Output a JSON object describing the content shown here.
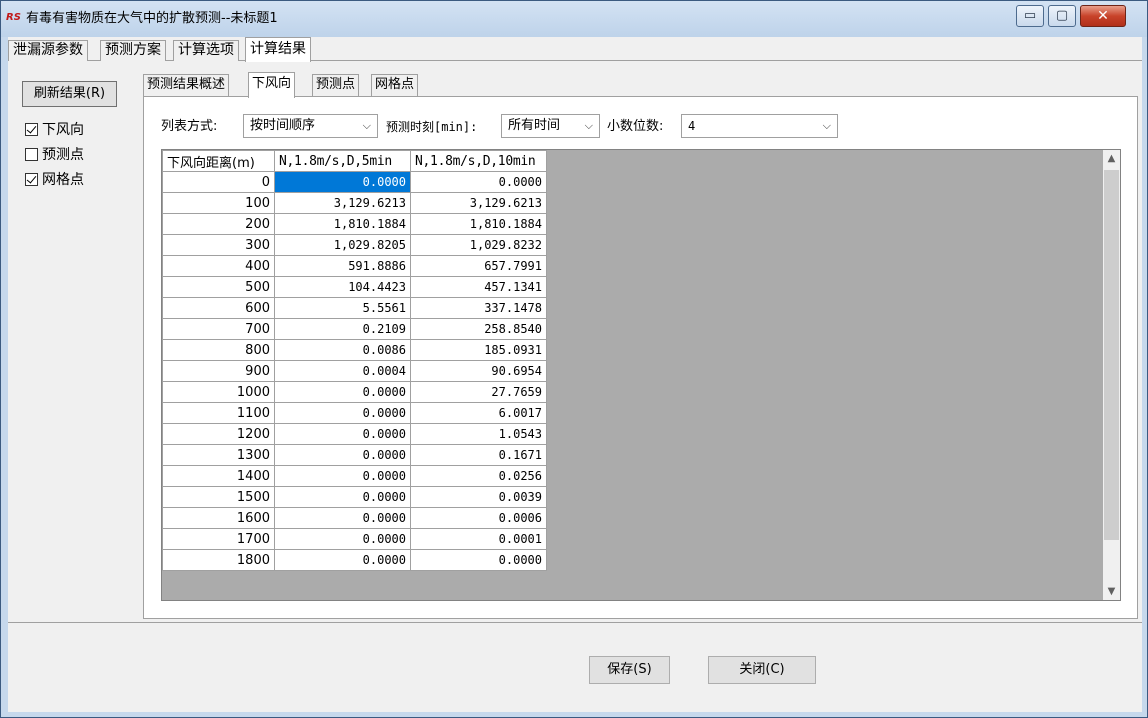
{
  "window": {
    "title": "有毒有害物质在大气中的扩散预测--未标题1",
    "app_icon": "RS",
    "controls": {
      "minimize": "▭",
      "maximize": "▢",
      "close": "✕"
    }
  },
  "tabs": [
    {
      "label": "泄漏源参数"
    },
    {
      "label": "预测方案"
    },
    {
      "label": "计算选项"
    },
    {
      "label": "计算结果",
      "active": true
    }
  ],
  "left": {
    "refresh_label": "刷新结果(R)",
    "checks": [
      {
        "label": "下风向",
        "checked": true
      },
      {
        "label": "预测点",
        "checked": false
      },
      {
        "label": "网格点",
        "checked": true
      }
    ]
  },
  "inner_tabs": [
    {
      "label": "预测结果概述"
    },
    {
      "label": "下风向",
      "active": true
    },
    {
      "label": "预测点"
    },
    {
      "label": "网格点"
    }
  ],
  "options": {
    "list_mode_label": "列表方式:",
    "list_mode_value": "按时间顺序",
    "time_label": "预测时刻[min]:",
    "time_value": "所有时间",
    "decimals_label": "小数位数:",
    "decimals_value": "4"
  },
  "table": {
    "headers": [
      "下风向距离(m)",
      "N,1.8m/s,D,5min",
      "N,1.8m/s,D,10min"
    ],
    "rows": [
      [
        "0",
        "0.0000",
        "0.0000"
      ],
      [
        "100",
        "3,129.6213",
        "3,129.6213"
      ],
      [
        "200",
        "1,810.1884",
        "1,810.1884"
      ],
      [
        "300",
        "1,029.8205",
        "1,029.8232"
      ],
      [
        "400",
        "591.8886",
        "657.7991"
      ],
      [
        "500",
        "104.4423",
        "457.1341"
      ],
      [
        "600",
        "5.5561",
        "337.1478"
      ],
      [
        "700",
        "0.2109",
        "258.8540"
      ],
      [
        "800",
        "0.0086",
        "185.0931"
      ],
      [
        "900",
        "0.0004",
        "90.6954"
      ],
      [
        "1000",
        "0.0000",
        "27.7659"
      ],
      [
        "1100",
        "0.0000",
        "6.0017"
      ],
      [
        "1200",
        "0.0000",
        "1.0543"
      ],
      [
        "1300",
        "0.0000",
        "0.1671"
      ],
      [
        "1400",
        "0.0000",
        "0.0256"
      ],
      [
        "1500",
        "0.0000",
        "0.0039"
      ],
      [
        "1600",
        "0.0000",
        "0.0006"
      ],
      [
        "1700",
        "0.0000",
        "0.0001"
      ],
      [
        "1800",
        "0.0000",
        "0.0000"
      ]
    ],
    "selected_row": 0,
    "selected_col": 1,
    "selection_color": "#0078d7"
  },
  "footer": {
    "save_label": "保存(S)",
    "close_label": "关闭(C)"
  }
}
